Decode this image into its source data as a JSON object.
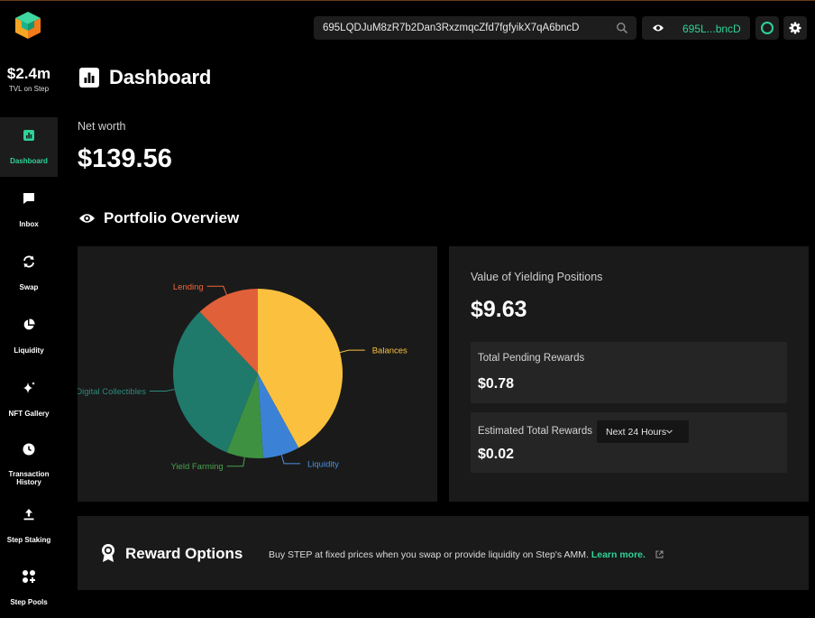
{
  "colors": {
    "accent": "#2ed398",
    "background": "#000000",
    "card": "#1a1a1a"
  },
  "sidebar": {
    "tvl_value": "$2.4m",
    "tvl_label": "TVL on Step",
    "items": [
      {
        "label": "Dashboard",
        "icon": "dashboard-icon",
        "active": true
      },
      {
        "label": "Inbox",
        "icon": "inbox-icon"
      },
      {
        "label": "Swap",
        "icon": "swap-icon"
      },
      {
        "label": "Liquidity",
        "icon": "liquidity-icon"
      },
      {
        "label": "NFT Gallery",
        "icon": "sparkle-icon"
      },
      {
        "label": "Transaction History",
        "icon": "clock-icon"
      },
      {
        "label": "Step Staking",
        "icon": "staking-icon"
      },
      {
        "label": "Step Pools",
        "icon": "pools-icon"
      }
    ]
  },
  "topbar": {
    "search_value": "695LQDJuM8zR7b2Dan3RxzmqcZfd7fgfyikX7qA6bncD",
    "wallet_short": "695L...bncD"
  },
  "main": {
    "title": "Dashboard",
    "net_worth_label": "Net worth",
    "net_worth_value": "$139.56",
    "portfolio_title": "Portfolio Overview"
  },
  "chart_data": {
    "type": "pie",
    "labels": [
      "Balances",
      "Liquidity",
      "Yield Farming",
      "Digital Collectibles",
      "Lending"
    ],
    "values": [
      42,
      7,
      7,
      32,
      12
    ],
    "colors": [
      "#fbc13e",
      "#3b82d6",
      "#3e9140",
      "#1f7a6c",
      "#e0603a"
    ],
    "label_colors": [
      "#fbc13e",
      "#4b93e6",
      "#4aa24c",
      "#2b8a7c",
      "#f0663a"
    ]
  },
  "yield": {
    "label": "Value of Yielding Positions",
    "value": "$9.63",
    "pending_label": "Total Pending Rewards",
    "pending_value": "$0.78",
    "estimated_label": "Estimated Total Rewards",
    "estimated_value": "$0.02",
    "period_selected": "Next 24 Hours"
  },
  "reward": {
    "title": "Reward Options",
    "description": "Buy STEP at fixed prices when you swap or provide liquidity on Step's AMM.",
    "learn_more": "Learn more."
  }
}
